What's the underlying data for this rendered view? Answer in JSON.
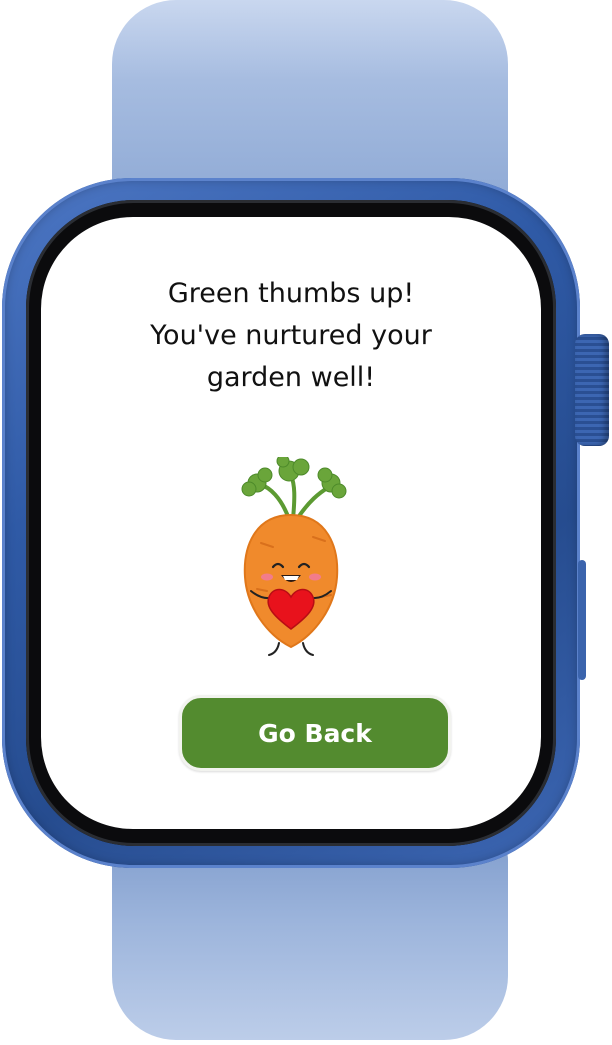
{
  "screen": {
    "message_lines": [
      "Green thumbs up!",
      "You've nurtured your",
      "garden well!"
    ],
    "illustration_icon": "carrot-holding-heart-icon",
    "button_label": "Go Back"
  },
  "colors": {
    "button": "#538b2f",
    "band": "#a6bce0",
    "case": "#2f5aa6"
  }
}
